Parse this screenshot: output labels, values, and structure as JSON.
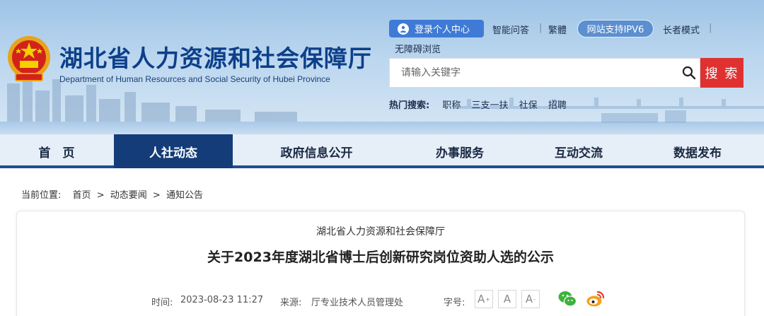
{
  "header": {
    "title": "湖北省人力资源和社会保障厅",
    "subtitle": "Department of Human Resources and Social Security of Hubei Province",
    "topbar": {
      "login": "登录个人中心",
      "qa": "智能问答",
      "traditional": "繁體",
      "ipv6": "网站支持IPV6",
      "elder": "长者模式",
      "accessible": "无障碍浏览",
      "divider": "|"
    },
    "search": {
      "placeholder": "请输入关键字",
      "button": "搜 索"
    },
    "hot": {
      "label": "热门搜索:",
      "keywords": [
        "职称",
        "三支一扶",
        "社保",
        "招聘"
      ]
    }
  },
  "nav": {
    "items": [
      "首　页",
      "人社动态",
      "政府信息公开",
      "办事服务",
      "互动交流",
      "数据发布"
    ],
    "active_index": 1
  },
  "breadcrumb": {
    "label": "当前位置:",
    "items": [
      "首页",
      "动态要闻",
      "通知公告"
    ],
    "separator": ">"
  },
  "article": {
    "department": "湖北省人力资源和社会保障厅",
    "title": "关于2023年度湖北省博士后创新研究岗位资助人选的公示",
    "time_label": "时间:",
    "time": "2023-08-23 11:27",
    "source_label": "来源:",
    "source": "厅专业技术人员管理处",
    "fontsize_label": "字号:",
    "fontsize_buttons": [
      "A",
      "A",
      "A"
    ]
  },
  "colors": {
    "nav_active": "#133c78",
    "search_button": "#e03131",
    "login_button": "#3f7bd6",
    "title_blue": "#0d3f8a"
  },
  "icons": {
    "emblem": "national-emblem-icon",
    "login": "user-circle-icon",
    "search": "search-icon",
    "wechat": "wechat-icon",
    "weibo": "weibo-icon"
  }
}
